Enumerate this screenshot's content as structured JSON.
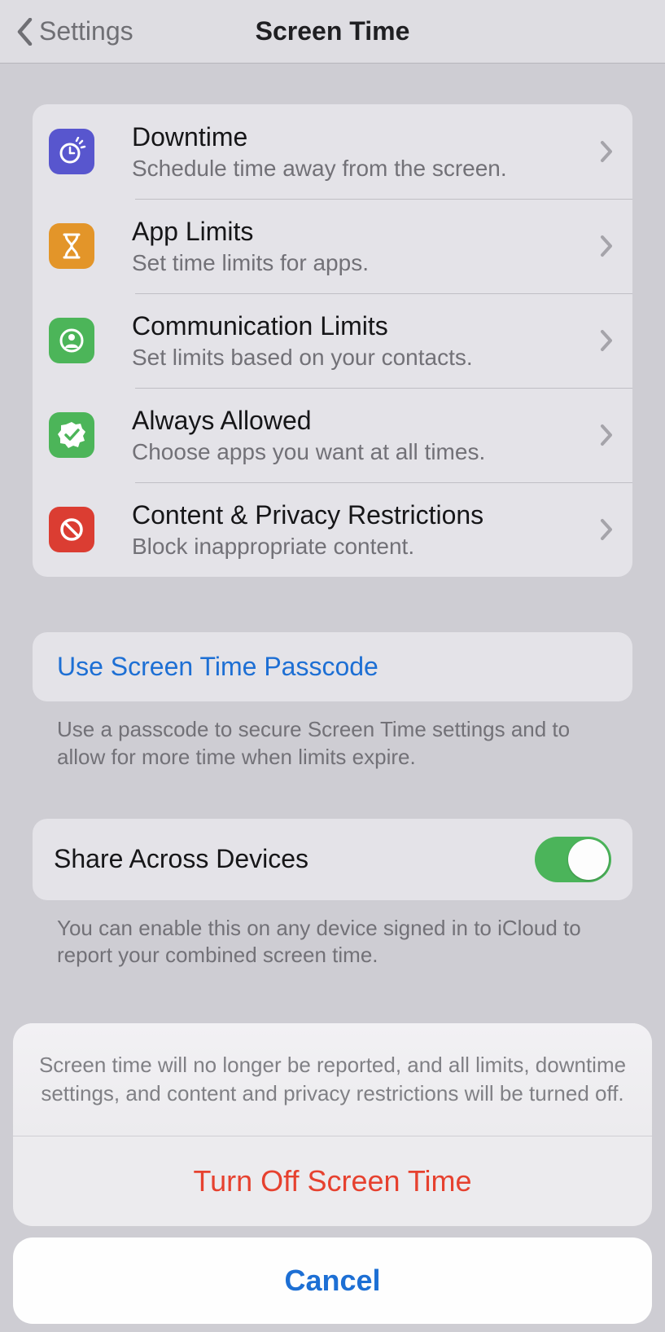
{
  "nav": {
    "back_label": "Settings",
    "title": "Screen Time"
  },
  "options": [
    {
      "title": "Downtime",
      "subtitle": "Schedule time away from the screen."
    },
    {
      "title": "App Limits",
      "subtitle": "Set time limits for apps."
    },
    {
      "title": "Communication Limits",
      "subtitle": "Set limits based on your contacts."
    },
    {
      "title": "Always Allowed",
      "subtitle": "Choose apps you want at all times."
    },
    {
      "title": "Content & Privacy Restrictions",
      "subtitle": "Block inappropriate content."
    }
  ],
  "passcode": {
    "link": "Use Screen Time Passcode",
    "footer": "Use a passcode to secure Screen Time settings and to allow for more time when limits expire."
  },
  "share": {
    "title": "Share Across Devices",
    "enabled": true,
    "footer": "You can enable this on any device signed in to iCloud to report your combined screen time."
  },
  "turnoff_behind": "Turn Off Screen Time",
  "sheet": {
    "message": "Screen time will no longer be reported, and all limits, downtime settings, and content and privacy restrictions will be turned off.",
    "destructive": "Turn Off Screen Time",
    "cancel": "Cancel"
  }
}
